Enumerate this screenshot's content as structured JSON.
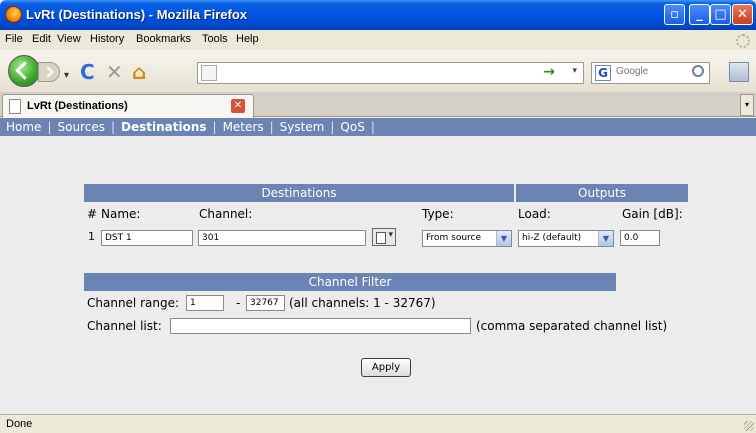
{
  "window": {
    "title": "LvRt (Destinations) - Mozilla Firefox"
  },
  "menu": [
    "File",
    "Edit",
    "View",
    "History",
    "Bookmarks",
    "Tools",
    "Help"
  ],
  "toolbar": {
    "url": "",
    "search_placeholder": "Google"
  },
  "tab": {
    "title": "LvRt (Destinations)"
  },
  "topnav": {
    "items": [
      "Home",
      "Sources",
      "Destinations",
      "Meters",
      "System",
      "QoS"
    ],
    "active": "Destinations"
  },
  "destinations": {
    "header": "Destinations",
    "outputs_header": "Outputs",
    "col_num": "#",
    "col_name": "Name:",
    "col_channel": "Channel:",
    "col_type": "Type:",
    "col_load": "Load:",
    "col_gain": "Gain [dB]:",
    "row": {
      "num": "1",
      "name": "DST 1",
      "channel": "301",
      "type": "From source",
      "load": "hi-Z (default)",
      "gain": "0.0"
    }
  },
  "channel_filter": {
    "header": "Channel Filter",
    "range_label": "Channel range:",
    "range_from": "1",
    "range_dash": "-",
    "range_to": "32767",
    "range_note": "(all channels: 1 - 32767)",
    "list_label": "Channel list:",
    "list_value": "",
    "list_note": "(comma separated channel list)"
  },
  "apply_label": "Apply",
  "status": "Done"
}
